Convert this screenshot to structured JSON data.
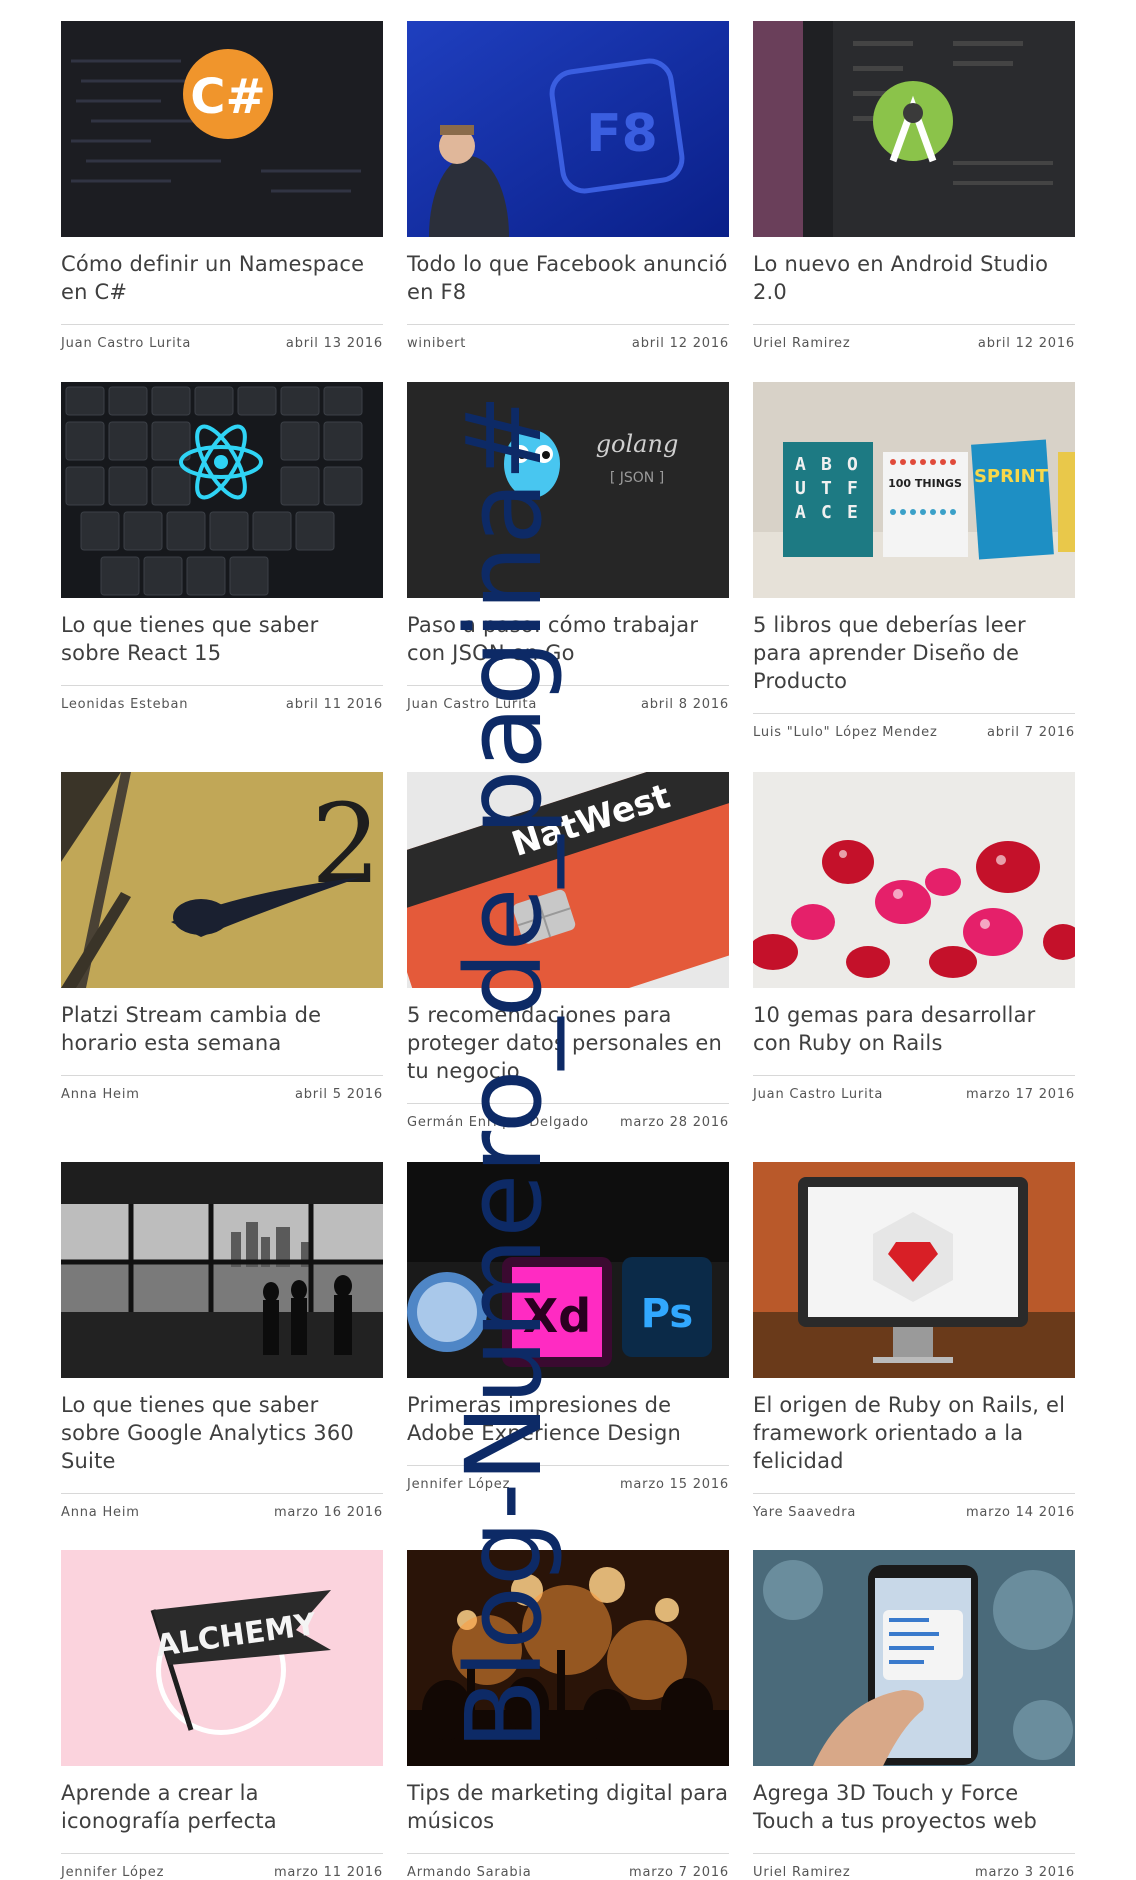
{
  "posts": [
    {
      "title": "Cómo definir un Namespace en C#",
      "author": "Juan Castro Lurita",
      "date": "abril 13 2016",
      "icon": "csharp-logo-icon"
    },
    {
      "title": "Todo lo que Facebook anunció en F8",
      "author": "winibert",
      "date": "abril 12 2016",
      "icon": "f8-logo-icon"
    },
    {
      "title": "Lo nuevo en Android Studio 2.0",
      "author": "Uriel Ramirez",
      "date": "abril 12 2016",
      "icon": "android-studio-logo-icon"
    },
    {
      "title": "Lo que tienes que saber sobre React 15",
      "author": "Leonidas Esteban",
      "date": "abril 11 2016",
      "icon": "react-logo-icon"
    },
    {
      "title": "Paso a paso: cómo trabajar con JSON en Go",
      "author": "Juan Castro Lurita",
      "date": "abril 8 2016",
      "icon": "golang-gopher-icon",
      "thumb_text": "golang",
      "thumb_sub": "[ JSON ]"
    },
    {
      "title": "5 libros que deberías leer para aprender Diseño de Producto",
      "author": "Luis \"Lulo\" López Mendez",
      "date": "abril 7 2016",
      "icon": "books-image",
      "thumb_text": "100 THINGS",
      "thumb_sub": "SPRINT",
      "thumb_letters": [
        "A",
        "B",
        "O",
        "U",
        "T",
        "F",
        "A",
        "C",
        "E"
      ]
    },
    {
      "title": "Platzi Stream cambia de horario esta semana",
      "author": "Anna Heim",
      "date": "abril 5 2016",
      "icon": "clock-hand-image"
    },
    {
      "title": "5 recomendaciones para proteger datos personales en tu negocio",
      "author": "Germán Enrique Delgado",
      "date": "marzo 28 2016",
      "icon": "credit-card-image",
      "thumb_text": "NatWest"
    },
    {
      "title": "10 gemas para desarrollar con Ruby on Rails",
      "author": "Juan Castro Lurita",
      "date": "marzo 17 2016",
      "icon": "ruby-gems-image"
    },
    {
      "title": "Lo que tienes que saber sobre Google Analytics 360 Suite",
      "author": "Anna Heim",
      "date": "marzo 16 2016",
      "icon": "city-view-image"
    },
    {
      "title": "Primeras impresiones de Adobe Experience Design",
      "author": "Jennifer López",
      "date": "marzo 15 2016",
      "icon": "adobe-xd-icon",
      "thumb_text": "Xd",
      "thumb_sub": "Ps"
    },
    {
      "title": "El origen de Ruby on Rails, el framework orientado a la felicidad",
      "author": "Yare Saavedra",
      "date": "marzo 14 2016",
      "icon": "ruby-monitor-image"
    },
    {
      "title": "Aprende a crear la iconografía perfecta",
      "author": "Jennifer López",
      "date": "marzo 11 2016",
      "icon": "alchemy-flag-icon",
      "thumb_text": "ALCHEMY"
    },
    {
      "title": "Tips de marketing digital para músicos",
      "author": "Armando Sarabia",
      "date": "marzo 7 2016",
      "icon": "concert-image"
    },
    {
      "title": "Agrega 3D Touch y Force Touch a tus proyectos web",
      "author": "Uriel Ramirez",
      "date": "marzo 3 2016",
      "icon": "phone-touch-image"
    }
  ],
  "overlay": {
    "text": "Blog-Numero_de_pagina#",
    "color": "#0d2a66"
  }
}
